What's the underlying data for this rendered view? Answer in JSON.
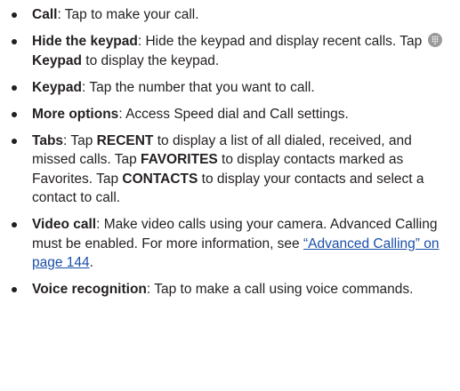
{
  "items": [
    {
      "term": "Call",
      "text": ": Tap to make your call."
    },
    {
      "term": "Hide the keypad",
      "text_before_icon": ": Hide the keypad and display recent calls. Tap ",
      "icon": "keypad-icon",
      "icon_label": "Keypad",
      "text_after_icon": " to display the keypad."
    },
    {
      "term": "Keypad",
      "text": ": Tap the number that you want to call."
    },
    {
      "term": "More options",
      "text": ": Access Speed dial and Call settings."
    },
    {
      "term": "Tabs",
      "t1": ": Tap ",
      "k1": "RECENT",
      "t2": " to display a list of all dialed, received, and missed calls. Tap ",
      "k2": "FAVORITES",
      "t3": " to display contacts marked as Favorites. Tap ",
      "k3": "CONTACTS",
      "t4": " to display your contacts and select a contact to call."
    },
    {
      "term": "Video call",
      "text": ": Make video calls using your camera. Advanced Calling must be enabled. For more information, see ",
      "link": "“Advanced Calling” on page 144",
      "after": "."
    },
    {
      "term": "Voice recognition",
      "text": ": Tap to make a call using voice commands."
    }
  ]
}
